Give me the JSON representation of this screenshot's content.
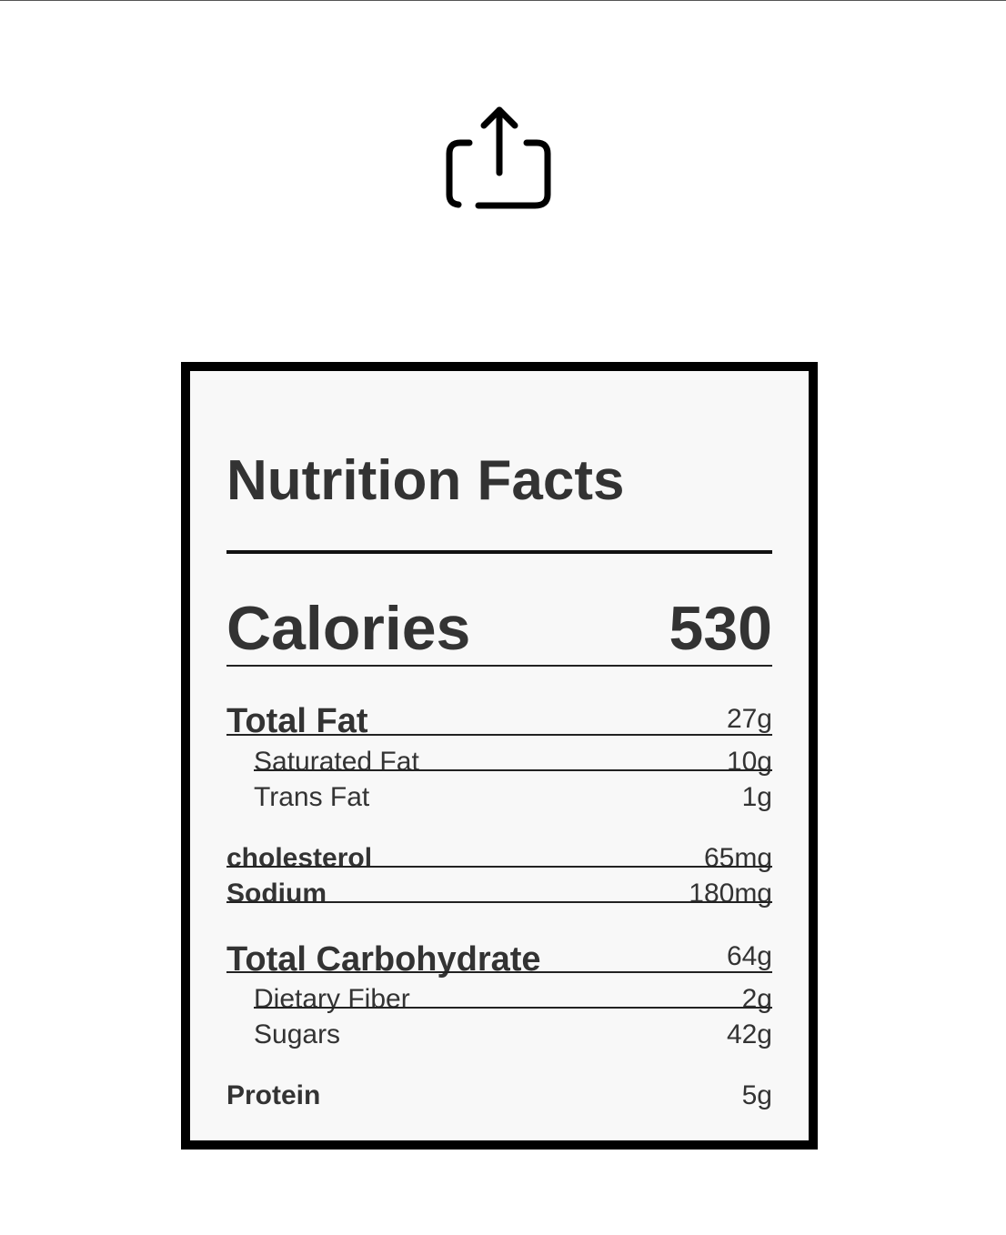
{
  "share": {
    "icon": "share-icon"
  },
  "nutrition": {
    "title": "Nutrition Facts",
    "calories_label": "Calories",
    "calories_value": "530",
    "total_fat": {
      "label": "Total Fat",
      "value": "27g"
    },
    "saturated_fat": {
      "label": "Saturated Fat",
      "value": "10g"
    },
    "trans_fat": {
      "label": "Trans Fat",
      "value": "1g"
    },
    "cholesterol": {
      "label": "cholesterol",
      "value": "65mg"
    },
    "sodium": {
      "label": "Sodium",
      "value": "180mg"
    },
    "total_carbohydrate": {
      "label": "Total Carbohydrate",
      "value": "64g"
    },
    "dietary_fiber": {
      "label": "Dietary Fiber",
      "value": "2g"
    },
    "sugars": {
      "label": "Sugars",
      "value": "42g"
    },
    "protein": {
      "label": "Protein",
      "value": "5g"
    }
  },
  "colors": {
    "border": "#000000",
    "label_background": "#f8f8f8",
    "text": "#333333"
  }
}
